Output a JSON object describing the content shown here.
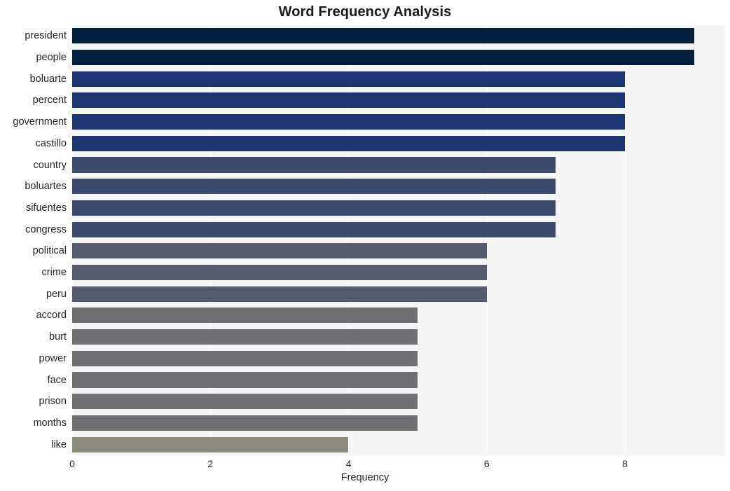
{
  "chart_data": {
    "type": "bar",
    "orientation": "horizontal",
    "title": "Word Frequency Analysis",
    "xlabel": "Frequency",
    "ylabel": "",
    "xlim": [
      0,
      9.45
    ],
    "xticks": [
      0,
      2,
      4,
      6,
      8
    ],
    "xtick_labels": [
      "0",
      "2",
      "4",
      "6",
      "8"
    ],
    "grid": "vertical-only",
    "legend": "none",
    "categories": [
      "president",
      "people",
      "boluarte",
      "percent",
      "government",
      "castillo",
      "country",
      "boluartes",
      "sifuentes",
      "congress",
      "political",
      "crime",
      "peru",
      "accord",
      "burt",
      "power",
      "face",
      "prison",
      "months",
      "like"
    ],
    "values": [
      9,
      9,
      8,
      8,
      8,
      8,
      7,
      7,
      7,
      7,
      6,
      6,
      6,
      5,
      5,
      5,
      5,
      5,
      5,
      4
    ],
    "bar_colors": [
      "#04203f",
      "#04203f",
      "#1b3672",
      "#1b3672",
      "#1b3672",
      "#1b3672",
      "#3c4a6b",
      "#3c4a6b",
      "#3c4a6b",
      "#3c4a6b",
      "#565c6e",
      "#565c6e",
      "#565c6e",
      "#6e7073",
      "#6e7073",
      "#6e7073",
      "#6e7073",
      "#6e7073",
      "#6e7073",
      "#8d8c7c"
    ],
    "plot_background": "#f5f5f6",
    "gridline_color": "#ffffff",
    "figure_background": "#ffffff"
  }
}
